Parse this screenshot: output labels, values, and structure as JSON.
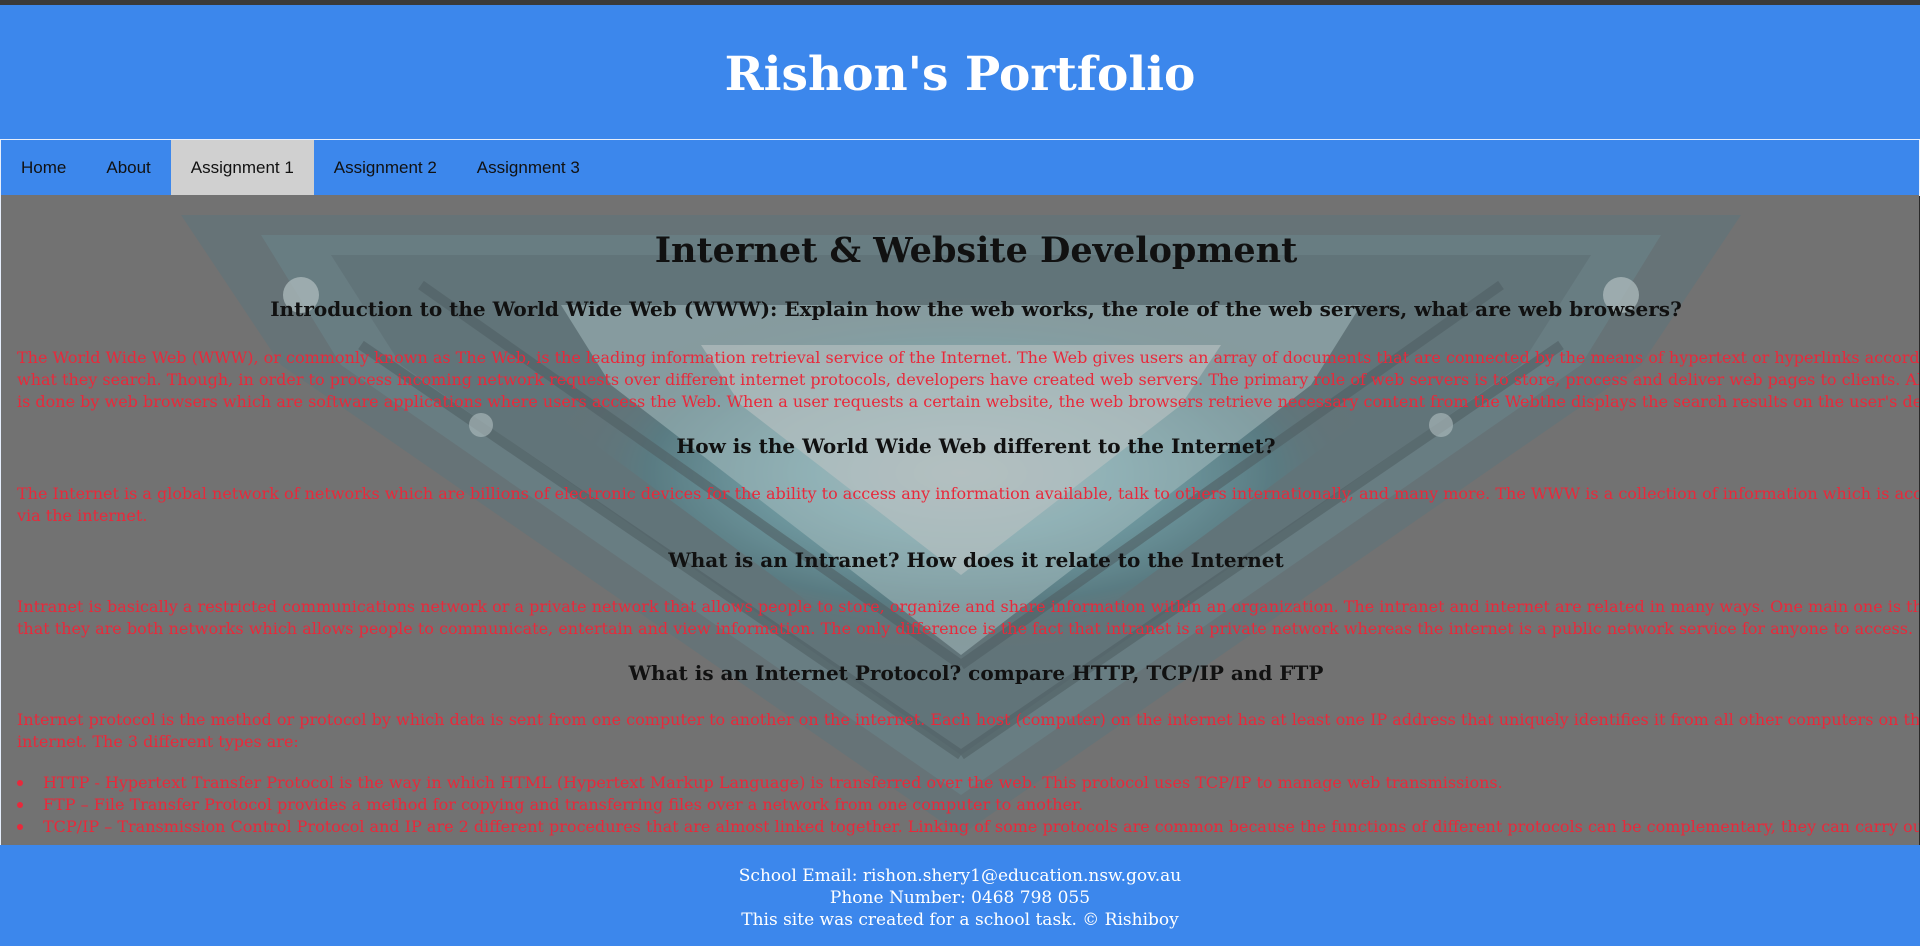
{
  "header": {
    "title": "Rishon's Portfolio"
  },
  "nav": {
    "items": [
      {
        "label": "Home"
      },
      {
        "label": "About"
      },
      {
        "label": "Assignment 1"
      },
      {
        "label": "Assignment 2"
      },
      {
        "label": "Assignment 3"
      }
    ],
    "active": "Assignment 1"
  },
  "main": {
    "title": "Internet & Website Development",
    "sections": [
      {
        "heading": "Introduction to the World Wide Web (WWW): Explain how the web works, the role of the web servers, what are web browsers?",
        "lines": [
          "The World Wide Web (WWW), or commonly known as The Web, is the leading information retrieval service of the Internet. The Web gives users an array of documents that are connected by the means of hypertext or hyperlinks according to",
          "what they search. Though, in order to process incoming network requests over different internet protocols, developers have created web servers. The primary role of web servers is to store, process and deliver web pages to clients. All of this",
          "is done by web browsers which are software applications where users access the Web. When a user requests a certain website, the web browsers retrieve necessary content from the Webthe displays the search results on the user's device."
        ]
      },
      {
        "heading": "How is the World Wide Web different to the Internet?",
        "lines": [
          "The Internet is a global network of networks which are billions of electronic devices for the ability to access any information available, talk to others internationally, and many more. The WWW is a collection of information which is accessed",
          "via the internet."
        ]
      },
      {
        "heading": "What is an Intranet? How does it relate to the Internet",
        "lines": [
          "Intranet is basically a restricted communications network or a private network that allows people to store, organize and share information within an organization. The intranet and internet are related in many ways. One main one is the fact",
          "that they are both networks which allows people to communicate, entertain and view information. The only difference is the fact that intranet is a private network whereas the internet is a public network service for anyone to access."
        ]
      },
      {
        "heading": "What is an Internet Protocol? compare HTTP, TCP/IP and FTP",
        "lines": [
          "Internet protocol is the method or protocol by which data is sent from one computer to another on the internet. Each host (computer) on the internet has at least one IP address that uniquely identifies it from all other computers on the",
          "internet. The 3 different types are:"
        ]
      }
    ],
    "bullets": [
      "HTTP - Hypertext Transfer Protocol is the way in which HTML (Hypertext Markup Language) is transferred over the web. This protocol uses TCP/IP to manage web transmissions.",
      "FTP – File Transfer Protocol provides a method for copying and transferring files over a network from one computer to another.",
      "TCP/IP – Transmission Control Protocol and IP are 2 different procedures that are almost linked together. Linking of some protocols are common because the functions of different protocols can be complementary, they can carry out and"
    ]
  },
  "footer": {
    "email": "School Email: rishon.shery1@education.nsw.gov.au",
    "phone": "Phone Number: 0468 798 055",
    "credit": "This site was created for a school task. © Rishiboy"
  },
  "colors": {
    "brand_blue": "#3c87ec",
    "text_red": "#e8293b",
    "active_tab": "#d0d0d0"
  }
}
